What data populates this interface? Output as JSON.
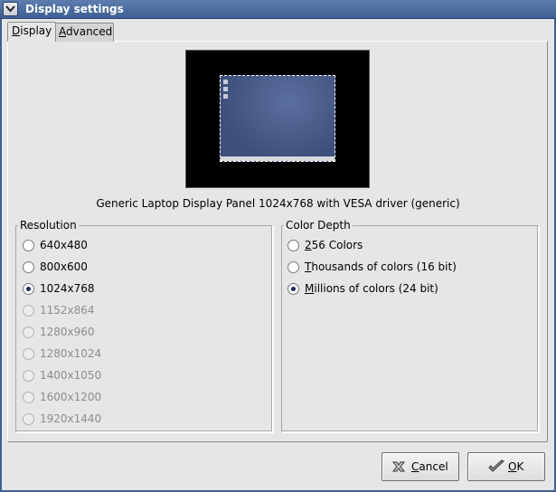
{
  "window": {
    "title": "Display settings"
  },
  "tabs": [
    {
      "label_accel": "D",
      "label_rest": "isplay",
      "active": true
    },
    {
      "label_accel": "A",
      "label_rest": "dvanced",
      "active": false
    }
  ],
  "display_description": "Generic Laptop Display Panel 1024x768 with VESA driver (generic)",
  "resolution": {
    "label": "Resolution",
    "selected": "1024x768",
    "options": [
      {
        "label": "640x480",
        "enabled": true
      },
      {
        "label": "800x600",
        "enabled": true
      },
      {
        "label": "1024x768",
        "enabled": true
      },
      {
        "label": "1152x864",
        "enabled": false
      },
      {
        "label": "1280x960",
        "enabled": false
      },
      {
        "label": "1280x1024",
        "enabled": false
      },
      {
        "label": "1400x1050",
        "enabled": false
      },
      {
        "label": "1600x1200",
        "enabled": false
      },
      {
        "label": "1920x1440",
        "enabled": false
      }
    ]
  },
  "color_depth": {
    "label": "Color Depth",
    "selected": "Millions of colors (24 bit)",
    "options": [
      {
        "accel": "2",
        "rest": "56 Colors",
        "label": "256 Colors"
      },
      {
        "accel": "T",
        "rest": "housands of colors (16 bit)",
        "label": "Thousands of colors (16 bit)"
      },
      {
        "accel": "M",
        "rest": "illions of colors (24 bit)",
        "label": "Millions of colors (24 bit)"
      }
    ]
  },
  "buttons": {
    "cancel": {
      "accel": "C",
      "rest": "ancel",
      "icon": "x-icon"
    },
    "ok": {
      "accel": "O",
      "rest": "K",
      "icon": "check-icon"
    }
  },
  "colors": {
    "titlebar": "#4a6a9d",
    "window_bg": "#e6e6e6",
    "preview_desktop": "#4a5c8a"
  }
}
